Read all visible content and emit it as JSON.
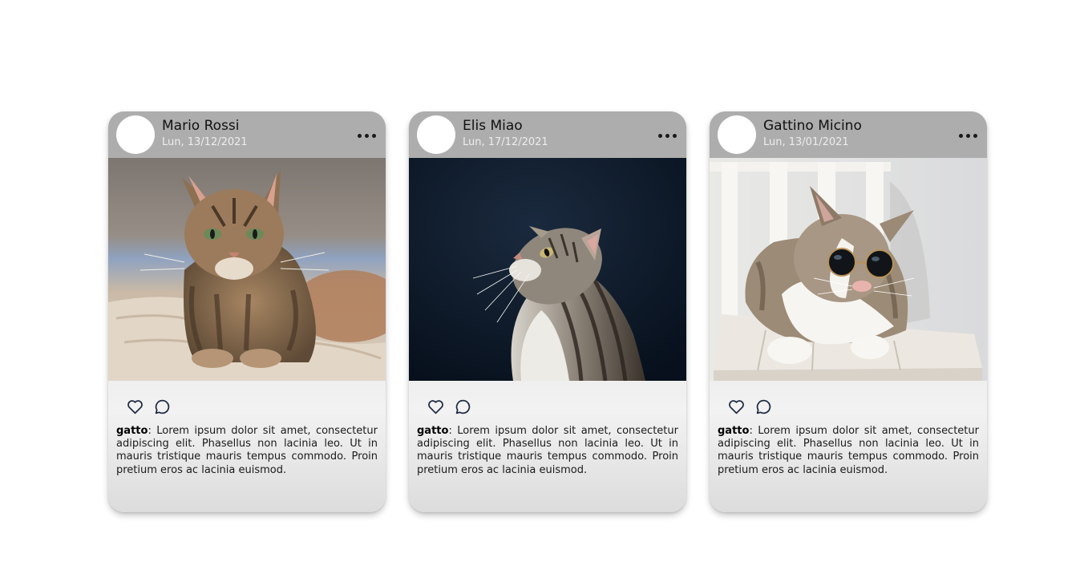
{
  "posts": [
    {
      "author": "Mario Rossi",
      "date": "Lun, 13/12/2021",
      "caption_tag": "gatto",
      "caption_text": ": Lorem ipsum dolor sit amet, consectetur adipiscing elit. Phasellus non lacinia leo. Ut in mauris tristique mauris tempus commodo. Proin pretium eros ac lacinia euismod.",
      "photo": "tabby-cat-lying-on-bed"
    },
    {
      "author": "Elis Miao",
      "date": "Lun, 17/12/2021",
      "caption_tag": "gatto",
      "caption_text": ": Lorem ipsum dolor sit amet, consectetur adipiscing elit. Phasellus non lacinia leo. Ut in mauris tristique mauris tempus commodo. Proin pretium eros ac lacinia euismod.",
      "photo": "tabby-cat-looking-up-dark-background"
    },
    {
      "author": "Gattino Micino",
      "date": "Lun, 13/01/2021",
      "caption_tag": "gatto",
      "caption_text": ": Lorem ipsum dolor sit amet, consectetur adipiscing elit. Phasellus non lacinia leo. Ut in mauris tristique mauris tempus commodo. Proin pretium eros ac lacinia euismod.",
      "photo": "cat-with-sunglasses-on-bench"
    }
  ],
  "icons": {
    "like": "heart-icon",
    "comment": "comment-icon",
    "menu": "more-options-icon"
  },
  "colors": {
    "header": "#adadad",
    "icon": "#1f2a44",
    "avatar": "#ffffff"
  }
}
